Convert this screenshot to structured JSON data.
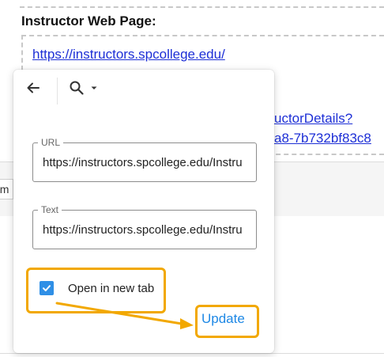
{
  "page": {
    "section_title": "Instructor Web Page:",
    "link_short": "https://instructors.spcollege.edu/",
    "link_line1": "uctorDetails?",
    "link_line2": "a8-7b732bf83c8",
    "band_field_text": "nm"
  },
  "popover": {
    "toolbar": {
      "back_icon": "arrow-left-icon",
      "search_icon": "search-icon",
      "dropdown_icon": "caret-down-icon"
    },
    "url_field": {
      "label": "URL",
      "value": "https://instructors.spcollege.edu/Instru"
    },
    "text_field": {
      "label": "Text",
      "value": "https://instructors.spcollege.edu/Instru"
    },
    "open_new_tab": {
      "label": "Open in new tab",
      "checked": true
    },
    "update_label": "Update"
  },
  "colors": {
    "accent": "#1e88e5",
    "checkbox": "#2f8fe6",
    "highlight": "#f2a800",
    "link": "#1d2fd6"
  }
}
